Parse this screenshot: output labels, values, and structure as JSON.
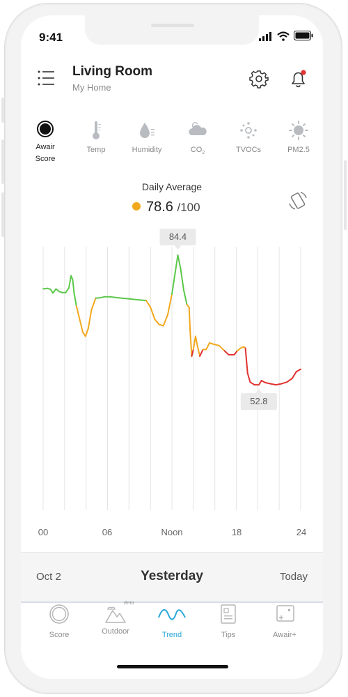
{
  "status": {
    "time": "9:41"
  },
  "header": {
    "title": "Living Room",
    "subtitle": "My Home"
  },
  "colors": {
    "good": "#5bc84a",
    "fair": "#f2a81d",
    "poor": "#e0332f",
    "accent": "#29a7d8"
  },
  "metrics": [
    {
      "label_line1": "Awair",
      "label_line2": "Score",
      "icon": "awair-score-icon",
      "active": true
    },
    {
      "label": "Temp",
      "icon": "thermometer-icon"
    },
    {
      "label": "Humidity",
      "icon": "humidity-icon"
    },
    {
      "label": "CO",
      "sub": "2",
      "icon": "co2-icon"
    },
    {
      "label": "TVOCs",
      "icon": "tvoc-icon"
    },
    {
      "label": "PM2.5",
      "icon": "pm25-icon"
    }
  ],
  "summary": {
    "label": "Daily Average",
    "value": "78.6",
    "denominator": "/100"
  },
  "chart_data": {
    "type": "line",
    "x_tick_labels": [
      "00",
      "06",
      "Noon",
      "18",
      "24"
    ],
    "xlim": [
      0,
      24
    ],
    "ylim": [
      0,
      100
    ],
    "score_thresholds": {
      "good_min": 80,
      "fair_min": 60
    },
    "series": [
      {
        "points": [
          [
            0,
            84
          ],
          [
            0.4,
            84.2
          ],
          [
            0.7,
            83.8
          ],
          [
            0.9,
            82.4
          ],
          [
            1.2,
            84
          ],
          [
            1.5,
            83
          ],
          [
            1.8,
            82.6
          ],
          [
            2.1,
            82.6
          ],
          [
            2.4,
            84.4
          ],
          [
            2.6,
            89
          ],
          [
            2.75,
            87.5
          ],
          [
            2.9,
            82
          ],
          [
            3.1,
            77.5
          ],
          [
            3.4,
            72.5
          ],
          [
            3.7,
            67.5
          ],
          [
            3.95,
            66
          ],
          [
            4.2,
            69
          ],
          [
            4.5,
            76
          ],
          [
            4.9,
            80.5
          ],
          [
            5.3,
            80.6
          ],
          [
            5.7,
            81
          ],
          [
            6.2,
            81
          ],
          [
            7,
            80.6
          ],
          [
            8,
            80.2
          ],
          [
            9,
            79.8
          ],
          [
            9.6,
            79.6
          ],
          [
            10,
            77
          ],
          [
            10.4,
            72.5
          ],
          [
            10.8,
            70.5
          ],
          [
            11.2,
            70
          ],
          [
            11.6,
            74
          ],
          [
            12,
            82
          ],
          [
            12.3,
            90
          ],
          [
            12.55,
            96.8
          ],
          [
            12.8,
            92
          ],
          [
            13.1,
            83.5
          ],
          [
            13.4,
            78
          ],
          [
            13.6,
            77
          ],
          [
            13.7,
            68
          ],
          [
            13.85,
            58.5
          ],
          [
            14,
            61
          ],
          [
            14.2,
            66
          ],
          [
            14.4,
            62
          ],
          [
            14.6,
            58.5
          ],
          [
            14.9,
            61
          ],
          [
            15.2,
            61
          ],
          [
            15.5,
            63.5
          ],
          [
            15.9,
            63
          ],
          [
            16.4,
            62.5
          ],
          [
            16.9,
            60.5
          ],
          [
            17.3,
            59
          ],
          [
            17.8,
            59
          ],
          [
            18.1,
            60.5
          ],
          [
            18.4,
            61.5
          ],
          [
            18.7,
            62
          ],
          [
            18.85,
            61.5
          ],
          [
            19.05,
            52
          ],
          [
            19.3,
            48.6
          ],
          [
            19.7,
            47.6
          ],
          [
            20.1,
            47.6
          ],
          [
            20.35,
            49.2
          ],
          [
            20.7,
            48.4
          ],
          [
            21.2,
            48
          ],
          [
            21.7,
            47.6
          ],
          [
            22.2,
            48
          ],
          [
            22.7,
            48.6
          ],
          [
            23.2,
            50
          ],
          [
            23.6,
            52.6
          ],
          [
            23.9,
            53.3
          ],
          [
            24,
            53.5
          ]
        ]
      }
    ],
    "annotations": [
      {
        "label": "84.4",
        "x": 12.55,
        "y": 96.8,
        "position": "above"
      },
      {
        "label": "52.8",
        "x": 20.1,
        "y": 47.6,
        "position": "below"
      }
    ],
    "grid": {
      "vertical": true,
      "horizontal": false
    }
  },
  "date_nav": {
    "prev": "Oct 2",
    "current": "Yesterday",
    "next": "Today"
  },
  "bottom_nav": [
    {
      "label": "Score",
      "icon": "score-ring-icon"
    },
    {
      "label": "Outdoor",
      "icon": "outdoor-mountain-icon",
      "badge": "Beta"
    },
    {
      "label": "Trend",
      "icon": "trend-wave-icon",
      "active": true
    },
    {
      "label": "Tips",
      "icon": "tips-document-icon"
    },
    {
      "label": "Awair+",
      "icon": "awair-plus-icon"
    }
  ]
}
